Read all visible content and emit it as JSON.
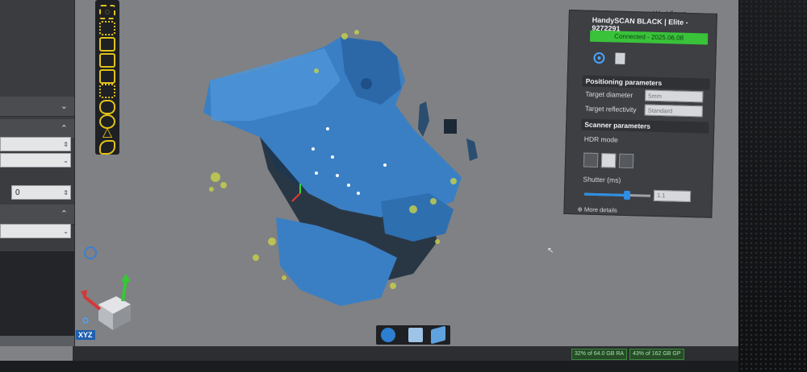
{
  "window": {
    "workflows_tab": "Workflows"
  },
  "left_panel": {
    "field_value": "0"
  },
  "toolbar": {
    "tools": [
      {
        "icon": "circle-dashed-icon"
      },
      {
        "icon": "lasso-icon"
      },
      {
        "icon": "select-rect-icon"
      },
      {
        "icon": "select-rect-icon-2"
      },
      {
        "icon": "select-rect-icon-3"
      },
      {
        "icon": "select-dots-icon"
      },
      {
        "icon": "loop-select-icon"
      },
      {
        "icon": "circle-select-icon"
      },
      {
        "icon": "triangle-select-icon"
      },
      {
        "icon": "freeform-select-icon"
      }
    ]
  },
  "scanner_panel": {
    "title": "HandySCAN BLACK | Elite - 9272291",
    "status": "Connected - 2025.06.08",
    "positioning_header": "Positioning parameters",
    "target_diameter_label": "Target diameter",
    "target_diameter_placeholder": "5mm",
    "target_reflectivity_label": "Target reflectivity",
    "target_reflectivity_placeholder": "Standard",
    "scanner_header": "Scanner parameters",
    "hdr_label": "HDR mode",
    "shutter_label": "Shutter (ms)",
    "shutter_value": "1.1",
    "shutter_level": 0.65,
    "more_details": "More details"
  },
  "gizmo": {
    "label": "XYZ"
  },
  "status_bar": {
    "memory": "32% of 64.0 GB RA",
    "disk": "43% of 162 GB GP"
  },
  "colors": {
    "accent_yellow": "#e2c21a",
    "connected_green": "#39c23a",
    "scan_blue": "#3a7fc4"
  }
}
